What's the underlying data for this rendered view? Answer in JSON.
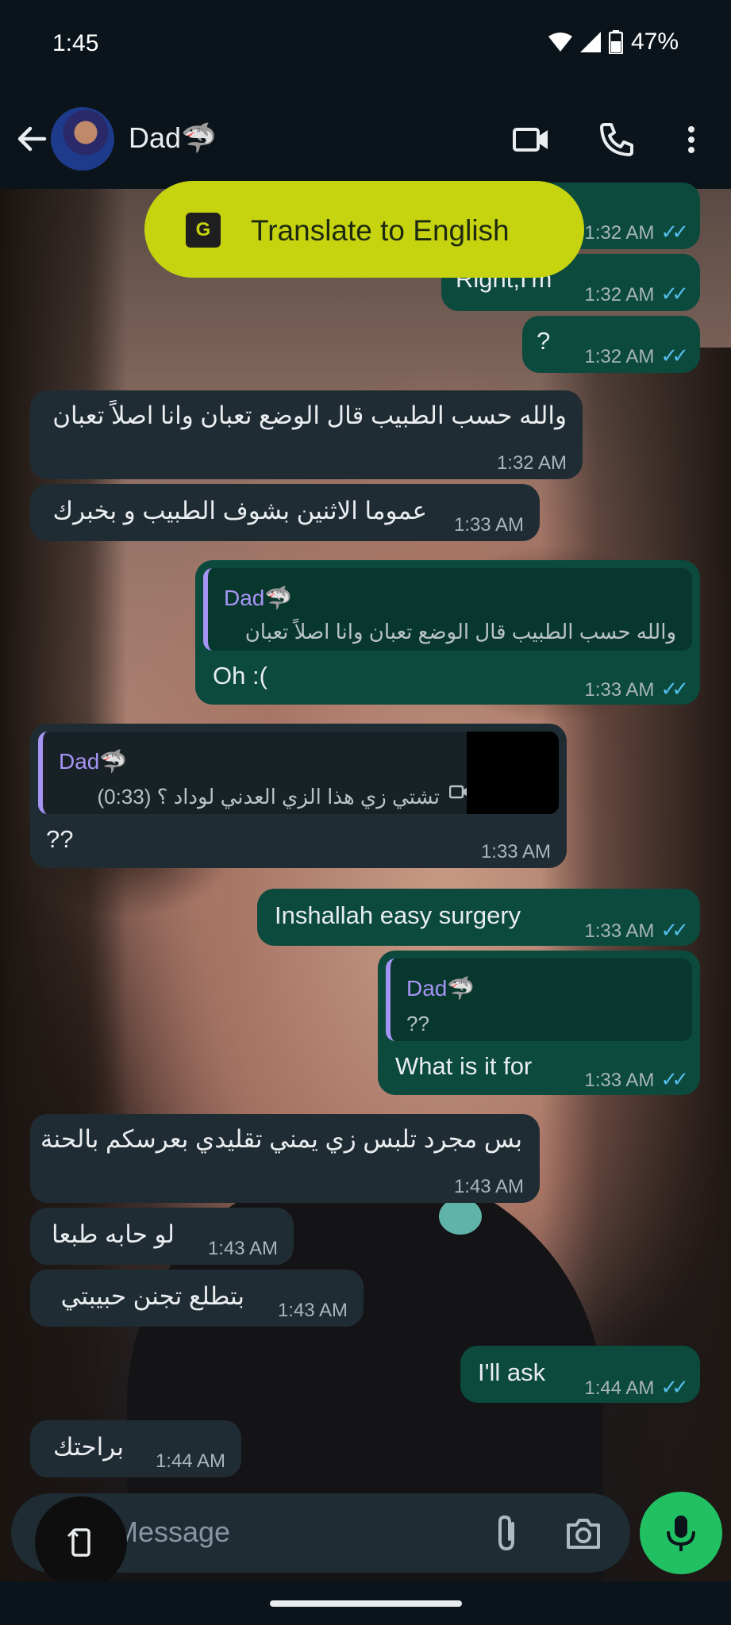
{
  "status_bar": {
    "time": "1:45",
    "battery": "47%"
  },
  "header": {
    "contact_name": "Dad🦈"
  },
  "translate_banner": {
    "label": "Translate to English"
  },
  "messages": [
    {
      "dir": "out",
      "text": "",
      "time": "1:32 AM",
      "ticks": "✓✓"
    },
    {
      "dir": "out",
      "text": "Right,I'm",
      "time": "1:32 AM",
      "ticks": "✓✓"
    },
    {
      "dir": "out",
      "text": "?",
      "time": "1:32 AM",
      "ticks": "✓✓"
    },
    {
      "dir": "in",
      "text": "والله حسب الطبيب قال الوضع تعبان وانا اصلاً تعبان",
      "time": "1:32 AM"
    },
    {
      "dir": "in",
      "text": "عموما الاثنين بشوف الطبيب و بخبرك",
      "time": "1:33 AM"
    },
    {
      "dir": "out",
      "quote_name": "Dad🦈",
      "quote_text": "والله حسب الطبيب قال الوضع تعبان وانا اصلاً تعبان",
      "text": "Oh :(",
      "time": "1:33 AM",
      "ticks": "✓✓"
    },
    {
      "dir": "in",
      "quote_name": "Dad🦈",
      "quote_text": "تشتي زي هذا الزي العدني لوداد ؟ (0:33)",
      "text": "??",
      "time": "1:33 AM"
    },
    {
      "dir": "out",
      "text": "Inshallah easy surgery",
      "time": "1:33 AM",
      "ticks": "✓✓"
    },
    {
      "dir": "out",
      "quote_name": "Dad🦈",
      "quote_text": "??",
      "text": "What is it for",
      "time": "1:33 AM",
      "ticks": "✓✓"
    },
    {
      "dir": "in",
      "text": "بس مجرد تلبس زي يمني تقليدي بعرسكم بالحنة",
      "time": "1:43 AM"
    },
    {
      "dir": "in",
      "text": "لو حابه طبعا",
      "time": "1:43 AM"
    },
    {
      "dir": "in",
      "text": "بتطلع تجنن حبيبتي",
      "time": "1:43 AM"
    },
    {
      "dir": "out",
      "text": "I'll ask",
      "time": "1:44 AM",
      "ticks": "✓✓"
    },
    {
      "dir": "in",
      "text": "براحتك",
      "time": "1:44 AM"
    }
  ],
  "composer": {
    "placeholder": "Message"
  },
  "icons": {
    "back": "arrow-left-icon",
    "video": "video-call-icon",
    "call": "phone-icon",
    "menu": "more-vert-icon",
    "translate": "translate-icon",
    "attach": "attach-icon",
    "camera": "camera-icon",
    "mic": "mic-icon",
    "emoji": "emoji-icon"
  },
  "colors": {
    "incoming": "#202c33",
    "outgoing": "#0b4a3d",
    "accent": "#21c063",
    "banner": "#c6d40f",
    "quote_name": "#a694f5",
    "ticks": "#53bdeb"
  }
}
